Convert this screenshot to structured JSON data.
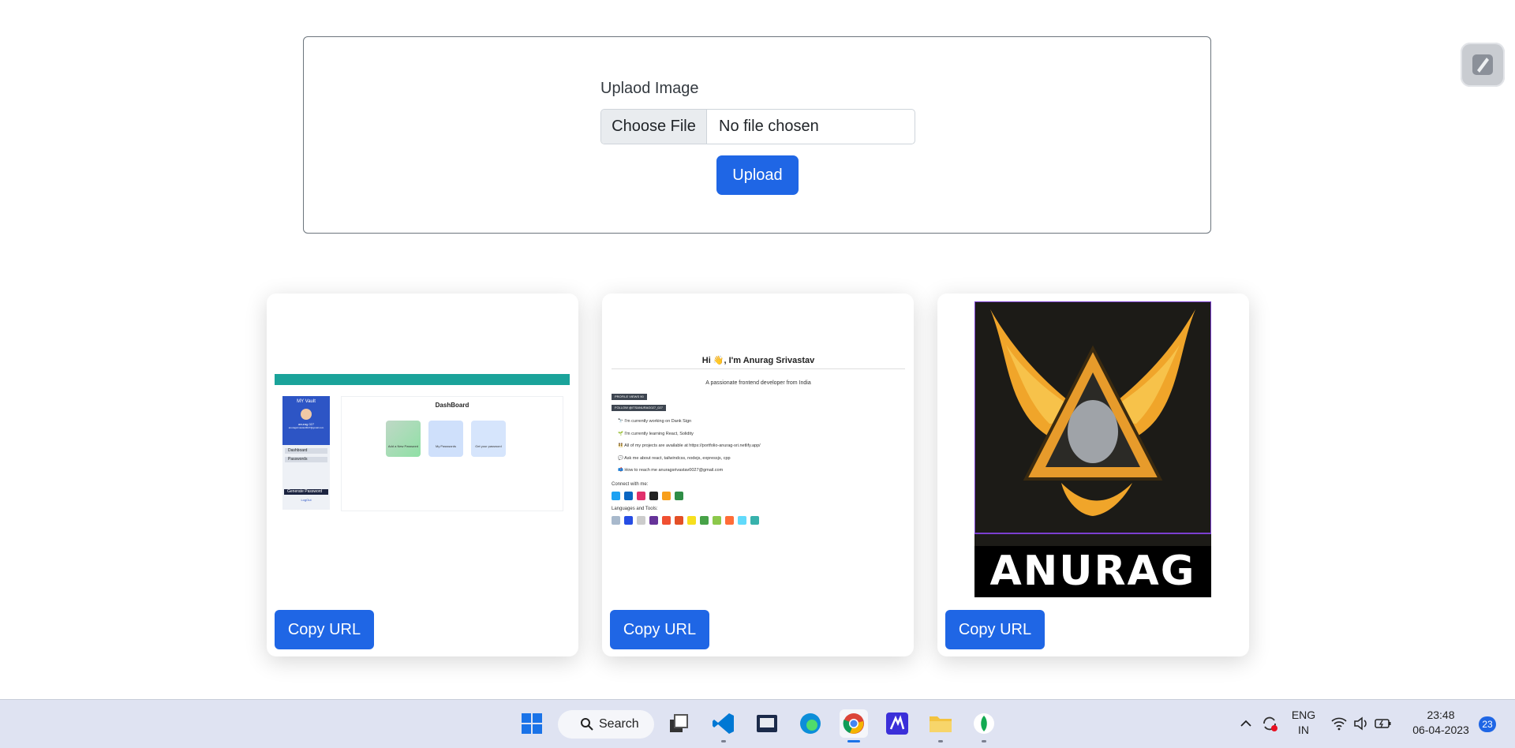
{
  "upload": {
    "label": "Uplaod Image",
    "choose_file": "Choose File",
    "file_status": "No file chosen",
    "upload_button": "Upload"
  },
  "cards": [
    {
      "copy_label": "Copy URL",
      "thumb": {
        "title": "DashBoard",
        "app_name": "MY Vault",
        "user": "anurag 027",
        "email": "anuragsrivastav0027@gmail.com",
        "nav": [
          "Dashboard",
          "Passwords"
        ],
        "generate": "Generate Password",
        "logout": "LogOut",
        "tiles": [
          "Add a New Password",
          "My Passwords",
          "Get your password"
        ]
      }
    },
    {
      "copy_label": "Copy URL",
      "thumb": {
        "title": "Hi 👋, I'm Anurag Srivastav",
        "subtitle": "A passionate frontend developer from India",
        "badges": [
          "PROFILE VIEWS 90",
          "FOLLOW @ITSANURAG027_027"
        ],
        "bullets": [
          "🔭 I'm currently working on Dank Sign",
          "🌱 I'm currently learning React, Solidity",
          "👯 All of my projects are available at https://portfolio-anurag-sri.netlify.app/",
          "💬 Ask me about react, tailwindcss, nodejs, expressjs, cpp",
          "📫 How to reach me anuragsrivastav0027@gmail.com"
        ],
        "connect": "Connect with me:",
        "languages": "Languages and Tools:"
      }
    },
    {
      "copy_label": "Copy URL",
      "thumb": {
        "text": "ANURAG"
      }
    }
  ],
  "taskbar": {
    "search_label": "Search",
    "lang": "ENG",
    "region": "IN",
    "time": "23:48",
    "date": "06-04-2023",
    "notifications": "23"
  },
  "colors": {
    "primary": "#1f66e5",
    "taskbar": "#dfe3f2"
  }
}
